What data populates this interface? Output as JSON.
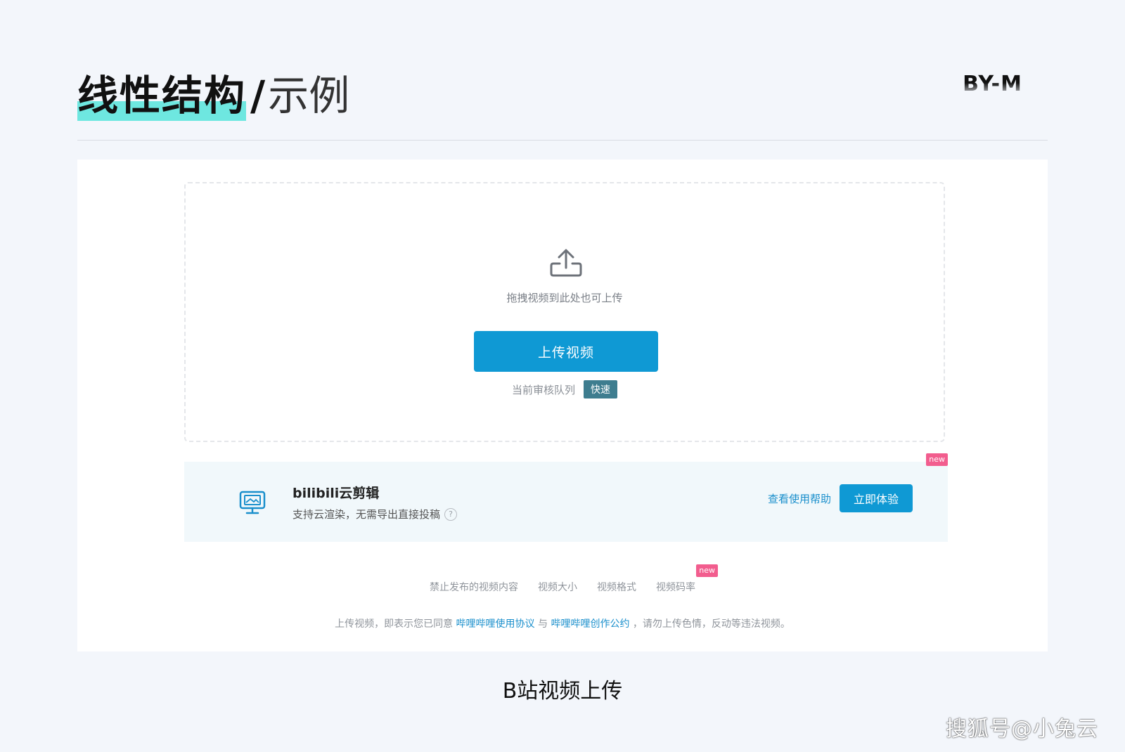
{
  "slide": {
    "title_bold": "线性结构",
    "title_separator": "/",
    "title_light": "示例",
    "brand": "BY-M",
    "caption": "B站视频上传",
    "watermark": "搜狐号@小兔云"
  },
  "upload": {
    "hint": "拖拽视频到此处也可上传",
    "button_label": "上传视频",
    "queue_label": "当前审核队列",
    "queue_tag": "快速"
  },
  "cloud_editor": {
    "new_badge": "new",
    "title": "bilibili云剪辑",
    "subtitle": "支持云渲染，无需导出直接投稿",
    "help_icon": "?",
    "help_link": "查看使用帮助",
    "try_button": "立即体验"
  },
  "rules": {
    "items": [
      "禁止发布的视频内容",
      "视频大小",
      "视频格式",
      "视频码率"
    ],
    "new_badge": "new"
  },
  "agreement": {
    "prefix": "上传视频，即表示您已同意",
    "link1": "哔哩哔哩使用协议",
    "middle": "与",
    "link2": "哔哩哔哩创作公约",
    "suffix": "，请勿上传色情，反动等违法视频。"
  },
  "colors": {
    "accent": "#0f99d4",
    "highlight": "#6ee7e0",
    "new_badge": "#f25d8e",
    "queue_tag": "#3e7d8f"
  }
}
